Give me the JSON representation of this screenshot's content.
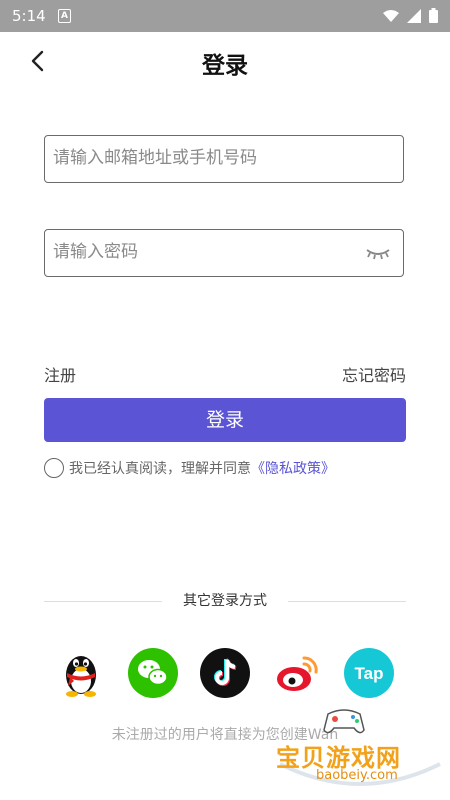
{
  "status_bar": {
    "time": "5:14",
    "notification_letter": "A"
  },
  "header": {
    "title": "登录"
  },
  "form": {
    "email_placeholder": "请输入邮箱地址或手机号码",
    "password_placeholder": "请输入密码"
  },
  "links": {
    "register": "注册",
    "forgot_password": "忘记密码"
  },
  "login_button": "登录",
  "agreement": {
    "text": "我已经认真阅读，理解并同意",
    "policy_link": "《隐私政策》"
  },
  "other_login": {
    "label": "其它登录方式",
    "providers": [
      "qq-icon",
      "wechat-icon",
      "tiktok-icon",
      "weibo-icon",
      "taptap-icon"
    ]
  },
  "note": "未注册过的用户将直接为您创建Wan",
  "watermark": {
    "cn": "宝贝游戏网",
    "en": "baobeiy.com"
  },
  "colors": {
    "accent": "#5b55d6",
    "status_bar": "#9e9e9e"
  }
}
